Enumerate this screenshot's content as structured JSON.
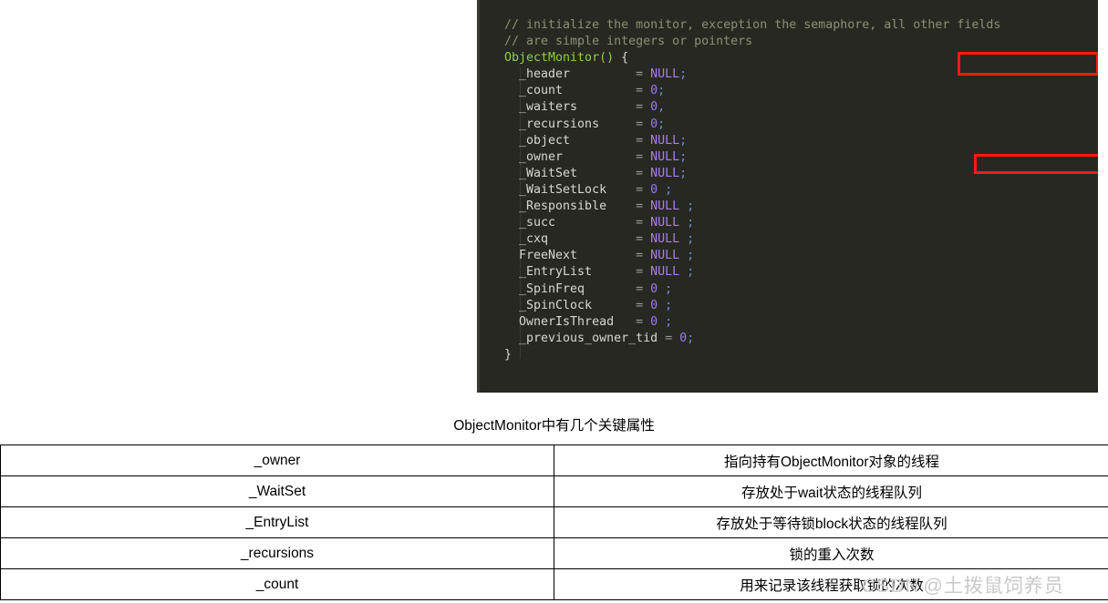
{
  "code_block": {
    "language_style": "dark-monokai",
    "background_color": "#272822",
    "lines": [
      {
        "id": "c1",
        "type": "comment",
        "text": "// initialize the monitor, exception the semaphore, all other fields"
      },
      {
        "id": "c2",
        "type": "comment",
        "text": "// are simple integers or pointers"
      },
      {
        "id": "c3",
        "type": "signature",
        "name": "ObjectMonitor()",
        "brace": " {"
      },
      {
        "id": "f1",
        "type": "assign",
        "field": "  _header",
        "pad": "         ",
        "eq": "= ",
        "value": "NULL",
        "value_kind": "null",
        "punct": ";"
      },
      {
        "id": "f2",
        "type": "assign",
        "field": "  _count",
        "pad": "          ",
        "eq": "= ",
        "value": "0",
        "value_kind": "num",
        "punct": ";"
      },
      {
        "id": "f3",
        "type": "assign",
        "field": "  _waiters",
        "pad": "        ",
        "eq": "= ",
        "value": "0",
        "value_kind": "num",
        "punct": ","
      },
      {
        "id": "f4",
        "type": "assign",
        "field": "  _recursions",
        "pad": "     ",
        "eq": "= ",
        "value": "0",
        "value_kind": "num",
        "punct": ";"
      },
      {
        "id": "f5",
        "type": "assign",
        "field": "  _object",
        "pad": "         ",
        "eq": "= ",
        "value": "NULL",
        "value_kind": "null",
        "punct": ";"
      },
      {
        "id": "f6",
        "type": "assign",
        "field": "  _owner",
        "pad": "          ",
        "eq": "= ",
        "value": "NULL",
        "value_kind": "null",
        "punct": ";"
      },
      {
        "id": "f7",
        "type": "assign",
        "field": "  _WaitSet",
        "pad": "        ",
        "eq": "= ",
        "value": "NULL",
        "value_kind": "null",
        "punct": ";"
      },
      {
        "id": "f8",
        "type": "assign",
        "field": "  _WaitSetLock",
        "pad": "    ",
        "eq": "= ",
        "value": "0",
        "value_kind": "num",
        "punct": " ;"
      },
      {
        "id": "f9",
        "type": "assign",
        "field": "  _Responsible",
        "pad": "    ",
        "eq": "= ",
        "value": "NULL",
        "value_kind": "null",
        "punct": " ;"
      },
      {
        "id": "f10",
        "type": "assign",
        "field": "  _succ",
        "pad": "           ",
        "eq": "= ",
        "value": "NULL",
        "value_kind": "null",
        "punct": " ;"
      },
      {
        "id": "f11",
        "type": "assign",
        "field": "  _cxq",
        "pad": "            ",
        "eq": "= ",
        "value": "NULL",
        "value_kind": "null",
        "punct": " ;"
      },
      {
        "id": "f12",
        "type": "assign",
        "field": "  FreeNext",
        "pad": "        ",
        "eq": "= ",
        "value": "NULL",
        "value_kind": "null",
        "punct": " ;"
      },
      {
        "id": "f13",
        "type": "assign",
        "field": "  _EntryList",
        "pad": "      ",
        "eq": "= ",
        "value": "NULL",
        "value_kind": "null",
        "punct": " ;"
      },
      {
        "id": "f14",
        "type": "assign",
        "field": "  _SpinFreq",
        "pad": "       ",
        "eq": "= ",
        "value": "0",
        "value_kind": "num",
        "punct": " ;"
      },
      {
        "id": "f15",
        "type": "assign",
        "field": "  _SpinClock",
        "pad": "      ",
        "eq": "= ",
        "value": "0",
        "value_kind": "num",
        "punct": " ;"
      },
      {
        "id": "f16",
        "type": "assign",
        "field": "  OwnerIsThread",
        "pad": "   ",
        "eq": "= ",
        "value": "0",
        "value_kind": "num",
        "punct": " ;"
      },
      {
        "id": "f17",
        "type": "assign",
        "field": "  _previous_owner_tid",
        "pad": " ",
        "eq": "= ",
        "value": "0",
        "value_kind": "num",
        "punct": ";"
      },
      {
        "id": "c4",
        "type": "brace",
        "text": "}"
      }
    ],
    "annotations": [
      {
        "id": "annot-ctor",
        "label": "ObjectMonitor()",
        "color": "#fd1a14"
      },
      {
        "id": "annot-owner",
        "label": "_owner = NULL;",
        "color": "#fd1a14"
      }
    ]
  },
  "caption": {
    "text": "ObjectMonitor中有几个关键属性"
  },
  "table": {
    "rows": [
      {
        "name": "_owner",
        "desc": "指向持有ObjectMonitor对象的线程"
      },
      {
        "name": "_WaitSet",
        "desc": "存放处于wait状态的线程队列"
      },
      {
        "name": "_EntryList",
        "desc": "存放处于等待锁block状态的线程队列"
      },
      {
        "name": "_recursions",
        "desc": "锁的重入次数"
      },
      {
        "name": "_count",
        "desc": "用来记录该线程获取锁的次数"
      }
    ]
  },
  "watermark": {
    "brand": "CSDN",
    "handle": "@土拨鼠饲养员"
  }
}
